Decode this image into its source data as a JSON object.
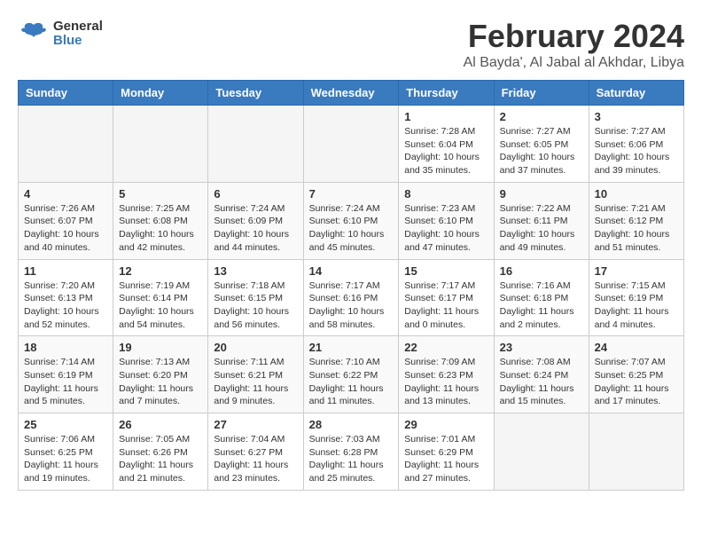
{
  "header": {
    "logo_line1": "General",
    "logo_line2": "Blue",
    "title": "February 2024",
    "subtitle": "Al Bayda', Al Jabal al Akhdar, Libya"
  },
  "weekdays": [
    "Sunday",
    "Monday",
    "Tuesday",
    "Wednesday",
    "Thursday",
    "Friday",
    "Saturday"
  ],
  "weeks": [
    [
      {
        "day": "",
        "info": ""
      },
      {
        "day": "",
        "info": ""
      },
      {
        "day": "",
        "info": ""
      },
      {
        "day": "",
        "info": ""
      },
      {
        "day": "1",
        "info": "Sunrise: 7:28 AM\nSunset: 6:04 PM\nDaylight: 10 hours\nand 35 minutes."
      },
      {
        "day": "2",
        "info": "Sunrise: 7:27 AM\nSunset: 6:05 PM\nDaylight: 10 hours\nand 37 minutes."
      },
      {
        "day": "3",
        "info": "Sunrise: 7:27 AM\nSunset: 6:06 PM\nDaylight: 10 hours\nand 39 minutes."
      }
    ],
    [
      {
        "day": "4",
        "info": "Sunrise: 7:26 AM\nSunset: 6:07 PM\nDaylight: 10 hours\nand 40 minutes."
      },
      {
        "day": "5",
        "info": "Sunrise: 7:25 AM\nSunset: 6:08 PM\nDaylight: 10 hours\nand 42 minutes."
      },
      {
        "day": "6",
        "info": "Sunrise: 7:24 AM\nSunset: 6:09 PM\nDaylight: 10 hours\nand 44 minutes."
      },
      {
        "day": "7",
        "info": "Sunrise: 7:24 AM\nSunset: 6:10 PM\nDaylight: 10 hours\nand 45 minutes."
      },
      {
        "day": "8",
        "info": "Sunrise: 7:23 AM\nSunset: 6:10 PM\nDaylight: 10 hours\nand 47 minutes."
      },
      {
        "day": "9",
        "info": "Sunrise: 7:22 AM\nSunset: 6:11 PM\nDaylight: 10 hours\nand 49 minutes."
      },
      {
        "day": "10",
        "info": "Sunrise: 7:21 AM\nSunset: 6:12 PM\nDaylight: 10 hours\nand 51 minutes."
      }
    ],
    [
      {
        "day": "11",
        "info": "Sunrise: 7:20 AM\nSunset: 6:13 PM\nDaylight: 10 hours\nand 52 minutes."
      },
      {
        "day": "12",
        "info": "Sunrise: 7:19 AM\nSunset: 6:14 PM\nDaylight: 10 hours\nand 54 minutes."
      },
      {
        "day": "13",
        "info": "Sunrise: 7:18 AM\nSunset: 6:15 PM\nDaylight: 10 hours\nand 56 minutes."
      },
      {
        "day": "14",
        "info": "Sunrise: 7:17 AM\nSunset: 6:16 PM\nDaylight: 10 hours\nand 58 minutes."
      },
      {
        "day": "15",
        "info": "Sunrise: 7:17 AM\nSunset: 6:17 PM\nDaylight: 11 hours\nand 0 minutes."
      },
      {
        "day": "16",
        "info": "Sunrise: 7:16 AM\nSunset: 6:18 PM\nDaylight: 11 hours\nand 2 minutes."
      },
      {
        "day": "17",
        "info": "Sunrise: 7:15 AM\nSunset: 6:19 PM\nDaylight: 11 hours\nand 4 minutes."
      }
    ],
    [
      {
        "day": "18",
        "info": "Sunrise: 7:14 AM\nSunset: 6:19 PM\nDaylight: 11 hours\nand 5 minutes."
      },
      {
        "day": "19",
        "info": "Sunrise: 7:13 AM\nSunset: 6:20 PM\nDaylight: 11 hours\nand 7 minutes."
      },
      {
        "day": "20",
        "info": "Sunrise: 7:11 AM\nSunset: 6:21 PM\nDaylight: 11 hours\nand 9 minutes."
      },
      {
        "day": "21",
        "info": "Sunrise: 7:10 AM\nSunset: 6:22 PM\nDaylight: 11 hours\nand 11 minutes."
      },
      {
        "day": "22",
        "info": "Sunrise: 7:09 AM\nSunset: 6:23 PM\nDaylight: 11 hours\nand 13 minutes."
      },
      {
        "day": "23",
        "info": "Sunrise: 7:08 AM\nSunset: 6:24 PM\nDaylight: 11 hours\nand 15 minutes."
      },
      {
        "day": "24",
        "info": "Sunrise: 7:07 AM\nSunset: 6:25 PM\nDaylight: 11 hours\nand 17 minutes."
      }
    ],
    [
      {
        "day": "25",
        "info": "Sunrise: 7:06 AM\nSunset: 6:25 PM\nDaylight: 11 hours\nand 19 minutes."
      },
      {
        "day": "26",
        "info": "Sunrise: 7:05 AM\nSunset: 6:26 PM\nDaylight: 11 hours\nand 21 minutes."
      },
      {
        "day": "27",
        "info": "Sunrise: 7:04 AM\nSunset: 6:27 PM\nDaylight: 11 hours\nand 23 minutes."
      },
      {
        "day": "28",
        "info": "Sunrise: 7:03 AM\nSunset: 6:28 PM\nDaylight: 11 hours\nand 25 minutes."
      },
      {
        "day": "29",
        "info": "Sunrise: 7:01 AM\nSunset: 6:29 PM\nDaylight: 11 hours\nand 27 minutes."
      },
      {
        "day": "",
        "info": ""
      },
      {
        "day": "",
        "info": ""
      }
    ]
  ]
}
